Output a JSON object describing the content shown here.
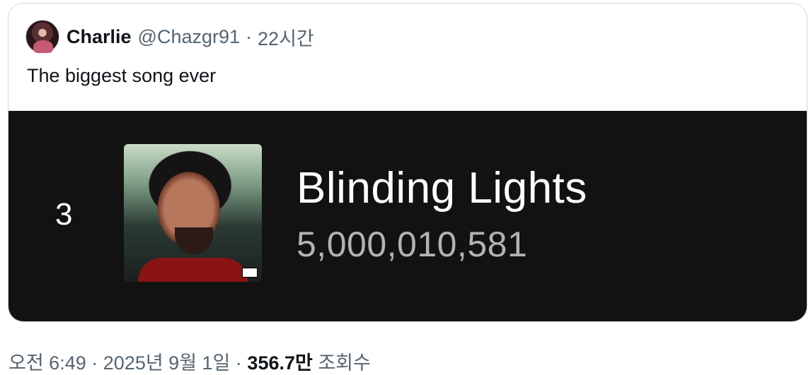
{
  "quoted_tweet": {
    "author_name": "Charlie",
    "handle": "@Chazgr91",
    "separator": "·",
    "time_ago": "22시간",
    "text": "The biggest song ever",
    "media": {
      "rank": "3",
      "song_title": "Blinding Lights",
      "stream_count": "5,000,010,581",
      "badge_text": "PARENTAL ADVISORY"
    }
  },
  "meta": {
    "time": "오전 6:49",
    "separator": "·",
    "date": "2025년 9월 1일",
    "separator2": "·",
    "views": "356.7만",
    "views_label": "조회수"
  },
  "colors": {
    "media_background": "#121212",
    "secondary_text": "#536471",
    "border": "#cfd9de"
  }
}
